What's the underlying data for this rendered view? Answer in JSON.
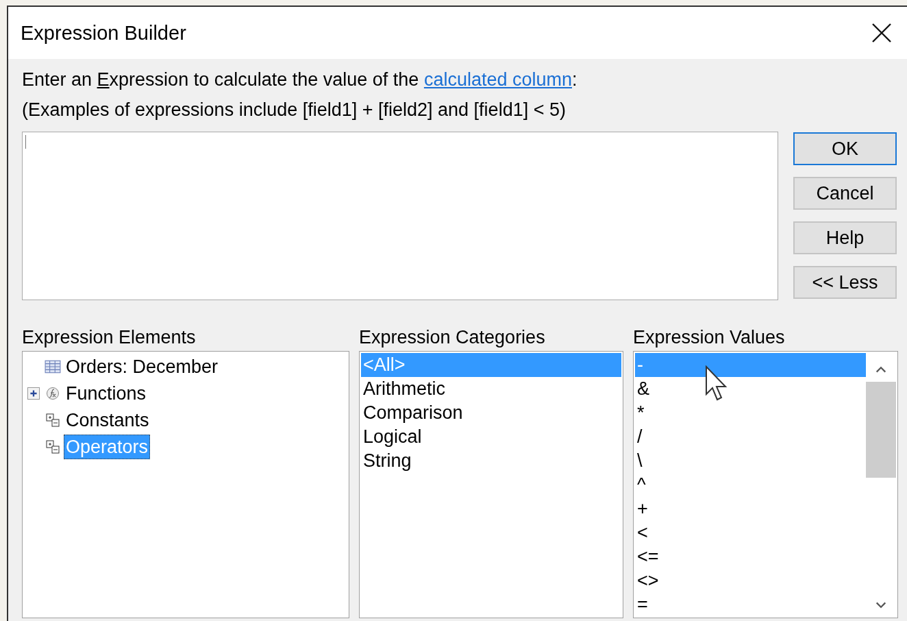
{
  "window": {
    "title": "Expression Builder"
  },
  "prompt": {
    "before": "Enter an ",
    "access_key": "E",
    "after": "xpression to calculate the value of the ",
    "link": "calculated column",
    "end": ":"
  },
  "examples": "(Examples of expressions include [field1] + [field2] and [field1] < 5)",
  "buttons": [
    {
      "label": "OK",
      "default": true
    },
    {
      "label": "Cancel",
      "default": false
    },
    {
      "label": "Help",
      "default": false
    },
    {
      "label": "<< Less",
      "default": false
    }
  ],
  "elements": {
    "label": "Expression Elements",
    "items": [
      {
        "label": "Orders: December",
        "kind": "table",
        "selected": false
      },
      {
        "label": "Functions",
        "kind": "functions",
        "expanded": false,
        "selected": false
      },
      {
        "label": "Constants",
        "kind": "group",
        "selected": false
      },
      {
        "label": "Operators",
        "kind": "group",
        "selected": true
      }
    ]
  },
  "categories": {
    "label": "Expression Categories",
    "items": [
      {
        "label": "<All>",
        "selected": true
      },
      {
        "label": "Arithmetic",
        "selected": false
      },
      {
        "label": "Comparison",
        "selected": false
      },
      {
        "label": "Logical",
        "selected": false
      },
      {
        "label": "String",
        "selected": false
      }
    ]
  },
  "values": {
    "label": "Expression Values",
    "items": [
      {
        "label": "-",
        "selected": true
      },
      {
        "label": "&",
        "selected": false
      },
      {
        "label": "*",
        "selected": false
      },
      {
        "label": "/",
        "selected": false
      },
      {
        "label": "\\",
        "selected": false
      },
      {
        "label": "^",
        "selected": false
      },
      {
        "label": "+",
        "selected": false
      },
      {
        "label": "<",
        "selected": false
      },
      {
        "label": "<=",
        "selected": false
      },
      {
        "label": "<>",
        "selected": false
      },
      {
        "label": "=",
        "selected": false
      }
    ]
  }
}
